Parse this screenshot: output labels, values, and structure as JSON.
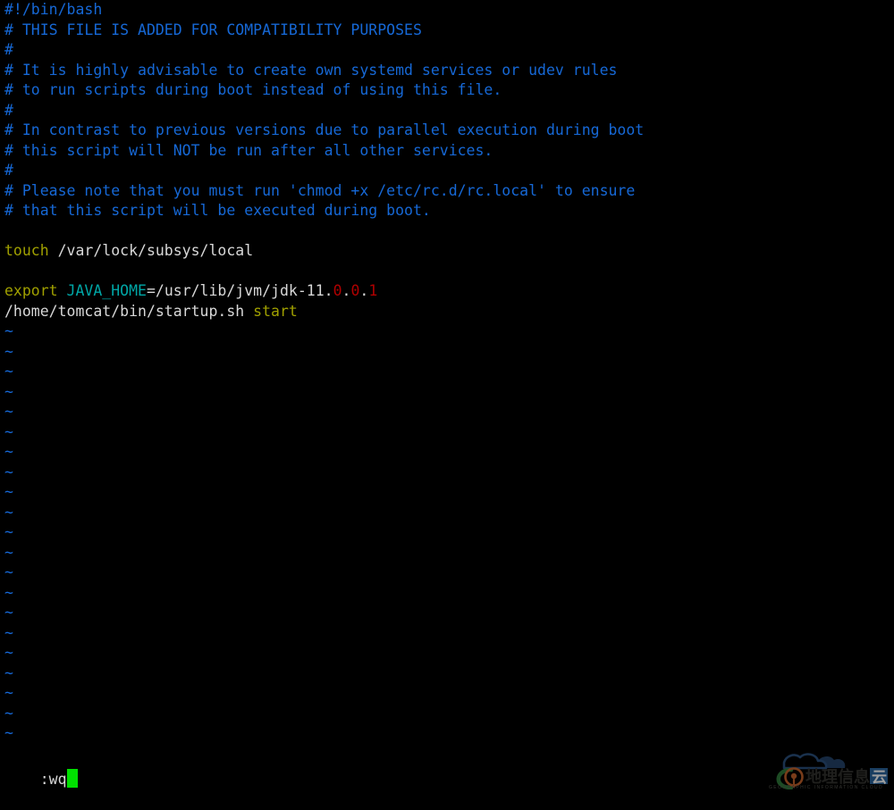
{
  "editor": {
    "name": "vim",
    "background_color": "#000000",
    "colors": {
      "comment": "#1668d6",
      "keyword": "#a0a000",
      "identifier": "#00a6a6",
      "plain_text": "#d8d8d8",
      "number": "#b00000",
      "tilde": "#1668d6",
      "cursor": "#00e000"
    },
    "lines": [
      {
        "type": "code",
        "tokens": [
          {
            "text": "#!/bin/bash",
            "cls": "c-comment"
          }
        ]
      },
      {
        "type": "code",
        "tokens": [
          {
            "text": "# THIS FILE IS ADDED FOR COMPATIBILITY PURPOSES",
            "cls": "c-comment"
          }
        ]
      },
      {
        "type": "code",
        "tokens": [
          {
            "text": "#",
            "cls": "c-comment"
          }
        ]
      },
      {
        "type": "code",
        "tokens": [
          {
            "text": "# It is highly advisable to create own systemd services or udev rules",
            "cls": "c-comment"
          }
        ]
      },
      {
        "type": "code",
        "tokens": [
          {
            "text": "# to run scripts during boot instead of using this file.",
            "cls": "c-comment"
          }
        ]
      },
      {
        "type": "code",
        "tokens": [
          {
            "text": "#",
            "cls": "c-comment"
          }
        ]
      },
      {
        "type": "code",
        "tokens": [
          {
            "text": "# In contrast to previous versions due to parallel execution during boot",
            "cls": "c-comment"
          }
        ]
      },
      {
        "type": "code",
        "tokens": [
          {
            "text": "# this script will NOT be run after all other services.",
            "cls": "c-comment"
          }
        ]
      },
      {
        "type": "code",
        "tokens": [
          {
            "text": "#",
            "cls": "c-comment"
          }
        ]
      },
      {
        "type": "code",
        "tokens": [
          {
            "text": "# Please note that you must run 'chmod +x /etc/rc.d/rc.local' to ensure",
            "cls": "c-comment"
          }
        ]
      },
      {
        "type": "code",
        "tokens": [
          {
            "text": "# that this script will be executed during boot.",
            "cls": "c-comment"
          }
        ]
      },
      {
        "type": "blank",
        "tokens": []
      },
      {
        "type": "code",
        "tokens": [
          {
            "text": "touch",
            "cls": "c-keyword"
          },
          {
            "text": " /var/lock/subsys/local",
            "cls": "c-plain"
          }
        ]
      },
      {
        "type": "blank",
        "tokens": []
      },
      {
        "type": "code",
        "tokens": [
          {
            "text": "export",
            "cls": "c-keyword"
          },
          {
            "text": " ",
            "cls": "c-plain"
          },
          {
            "text": "JAVA_HOME",
            "cls": "c-ident"
          },
          {
            "text": "=/usr/lib/jvm/jdk-11.",
            "cls": "c-plain"
          },
          {
            "text": "0",
            "cls": "c-number"
          },
          {
            "text": ".",
            "cls": "c-plain"
          },
          {
            "text": "0",
            "cls": "c-number"
          },
          {
            "text": ".",
            "cls": "c-plain"
          },
          {
            "text": "1",
            "cls": "c-number"
          }
        ]
      },
      {
        "type": "code",
        "tokens": [
          {
            "text": "/home/tomcat/bin/startup.sh ",
            "cls": "c-plain"
          },
          {
            "text": "start",
            "cls": "c-keyword"
          }
        ]
      }
    ],
    "empty_line_marker": "~",
    "empty_line_count": 21,
    "statusline": {
      "text": ":wq",
      "cursor_visible": true
    }
  },
  "watermark": {
    "title": "地理信息云",
    "subtitle": "GEOGRAPHIC INFORMATION CLOUD",
    "colors": {
      "cloud": "#2a4f7c",
      "arc": "#2f7a3a",
      "pin": "#c2622a",
      "text": "#33332f",
      "accent": "#2f6fae"
    }
  }
}
